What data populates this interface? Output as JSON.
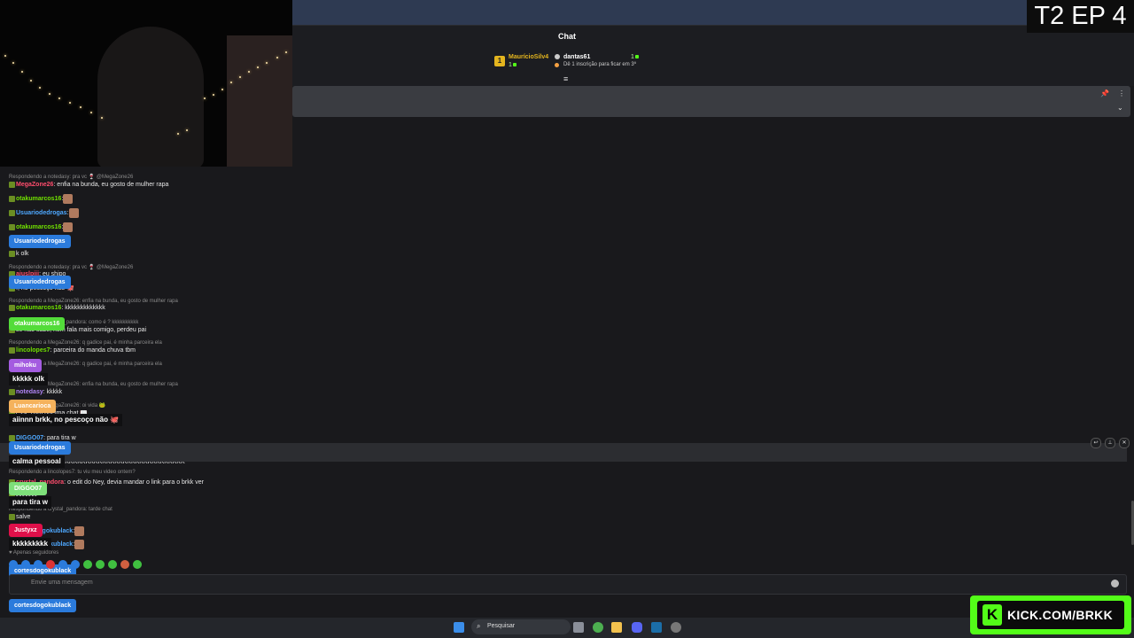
{
  "overlay": {
    "episode_label": "T2 EP 4",
    "promo_url": "KICK.COM/BRKK"
  },
  "chat": {
    "title": "Chat",
    "leaderboard": [
      {
        "rank": "1",
        "name": "MaurícioSilv4",
        "count": "1",
        "color": "#e4b51e"
      },
      {
        "name": "dantas61",
        "count": "1",
        "color": "#ffffff"
      }
    ],
    "leaderboard_note": "Dê 1 inscrição para ficar em 3º",
    "composer_placeholder": "Envie uma mensagem",
    "followers_only": "Apenas seguidores"
  },
  "messages": [
    {
      "reply": "Respondendo a notedasy: pra vc 🍷 @MegaZone26"
    },
    {
      "user": "MegaZone26",
      "color": "#ff4d6d",
      "text": ": enfia na bunda, eu gosto de mulher rapa"
    },
    {
      "user": "otakumarcos16",
      "color": "#70e000",
      "text": ":"
    },
    {
      "user": "Usuariodedrogas",
      "color": "#4ea8ff",
      "text": ":"
    },
    {
      "user": "otakumarcos16",
      "color": "#70e000",
      "text": ":"
    },
    {
      "user": "",
      "color": "#e6e6e6",
      "text": "k olk"
    },
    {
      "reply": "Respondendo a notedasy: pra vc 🍷 @MegaZone26"
    },
    {
      "user": "ajuslpiii",
      "color": "#ff4d6d",
      "text": ": eu shipo"
    },
    {
      "user": "",
      "color": "#e6e6e6",
      "text": "., no pescoço não 🐙"
    },
    {
      "reply": "Respondendo a MegaZone26: enfia na bunda, eu gosto de mulher rapa"
    },
    {
      "user": "otakumarcos16",
      "color": "#70e000",
      "text": ": kkkkkkkkkkkkk"
    },
    {
      "reply": "Respondendo a crystal_pandora: como é ? kkkkkkkkkk"
    },
    {
      "user": "",
      "color": "#e6e6e6",
      "text": "se não sabe, nem fala mais comigo, perdeu pai"
    },
    {
      "reply": "Respondendo a MegaZone26: q gadice pai, é minha parceira ela"
    },
    {
      "user": "lincolopes7",
      "color": "#70e000",
      "text": ": parceira do manda chuva tbm"
    },
    {
      "reply": "Respondendo a MegaZone26: q gadice pai, é minha parceira ela"
    },
    {
      "reply": "Respondendo a MegaZone26: enfia na bunda, eu gosto de mulher rapa"
    },
    {
      "user": "notedasy",
      "color": "#b084f5",
      "text": ": kkkkk"
    },
    {
      "reply": "Respondendo a MegaZone26: oi vida 🐸"
    },
    {
      "user": "",
      "color": "#e6e6e6",
      "text": "esse cara queima chat 📖"
    },
    {
      "user": "DIGGO07",
      "color": "#4ea8ff",
      "text": ": para tira w"
    },
    {
      "reply": "Respondendo a lincolopes7: parceira do manda chuva tbm"
    },
    {
      "user": "",
      "color": "#e6e6e6",
      "text": ": KKKKKKKKKKKKKKKKKKKKKKKKKKKKKKKKKKKKKKKK"
    },
    {
      "reply": "Respondendo a lincolopes7: tu viu meu video ontem?"
    },
    {
      "user": "crystal_pandora",
      "color": "#ff4d6d",
      "text": ": o edit do Ney, devia mandar o link para o brkk ver"
    },
    {
      "user": "",
      "color": "#e6e6e6",
      "text": "kkkkkkk"
    },
    {
      "reply": "Respondendo a crystal_pandora: tarde chat"
    },
    {
      "user": "",
      "color": "#e6e6e6",
      "text": "salve"
    },
    {
      "user": "cortesdogokublack",
      "color": "#4ea8ff",
      "text": ":"
    },
    {
      "user": "cortesdogokublack",
      "color": "#4ea8ff",
      "text": ":"
    }
  ],
  "popups": [
    {
      "user": "Usuariodedrogas",
      "color": "#2b7bdc",
      "text": ""
    },
    {
      "user": "Usuariodedrogas",
      "color": "#2b7bdc",
      "text": ""
    },
    {
      "user": "otakumarcos16",
      "color": "#53dc3a",
      "text": ""
    },
    {
      "user": "mihoku",
      "color": "#a45ce0",
      "text": "kkkkk olk"
    },
    {
      "user": "Luancarioca",
      "color": "#f5b25c",
      "text": "aiinnn brkk, no pescoço não 🐙"
    },
    {
      "user": "Usuariodedrogas",
      "color": "#2b7bdc",
      "text": "calma pessoal"
    },
    {
      "user": "DIGGO07",
      "color": "#7ee07a",
      "text": "para tira w"
    },
    {
      "user": "Justyxz",
      "color": "#e0104a",
      "text": "kkkkkkkkk"
    },
    {
      "user": "cortesdogokublack",
      "color": "#2b7bdc",
      "text": ""
    },
    {
      "user": "cortesdogokublack",
      "color": "#2b7bdc",
      "text": ""
    }
  ],
  "taskbar": {
    "search_label": "Pesquisar"
  },
  "colors": {
    "kick_green": "#53fc18",
    "chat_bg": "#19191c"
  }
}
